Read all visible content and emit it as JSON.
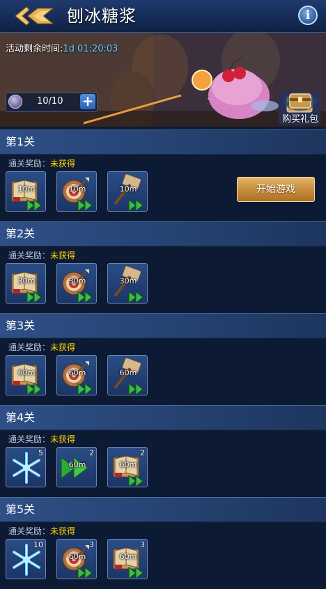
{
  "header": {
    "title": "刨冰糖浆"
  },
  "banner": {
    "timer_label": "活动剩余时间:",
    "timer_value": "1d 01:20:03",
    "stamina": "10/10",
    "plus": "+",
    "gift_label": "购买礼包"
  },
  "reward_prefix": "通关奖励：",
  "start_button": "开始游戏",
  "levels": [
    {
      "title": "第1关",
      "status": "未获得",
      "items": [
        {
          "icon": "book-icon",
          "label": "10m",
          "qty": ""
        },
        {
          "icon": "target-icon",
          "label": "10m",
          "qty": ""
        },
        {
          "icon": "hammer-icon",
          "label": "10m",
          "qty": ""
        }
      ]
    },
    {
      "title": "第2关",
      "status": "未获得",
      "items": [
        {
          "icon": "book-icon",
          "label": "30m",
          "qty": ""
        },
        {
          "icon": "target-icon",
          "label": "30m",
          "qty": ""
        },
        {
          "icon": "hammer-icon",
          "label": "30m",
          "qty": ""
        }
      ]
    },
    {
      "title": "第3关",
      "status": "未获得",
      "items": [
        {
          "icon": "book-icon",
          "label": "60m",
          "qty": ""
        },
        {
          "icon": "target-icon",
          "label": "60m",
          "qty": ""
        },
        {
          "icon": "hammer-icon",
          "label": "60m",
          "qty": ""
        }
      ]
    },
    {
      "title": "第4关",
      "status": "未获得",
      "items": [
        {
          "icon": "snowflake-icon",
          "label": "",
          "qty": "5"
        },
        {
          "icon": "speedup-icon",
          "label": "60m",
          "qty": "2"
        },
        {
          "icon": "book-icon",
          "label": "60m",
          "qty": "2"
        }
      ]
    },
    {
      "title": "第5关",
      "status": "未获得",
      "items": [
        {
          "icon": "snowflake-icon",
          "label": "",
          "qty": "10"
        },
        {
          "icon": "target-icon",
          "label": "60m",
          "qty": "3"
        },
        {
          "icon": "book-icon",
          "label": "60m",
          "qty": "3"
        }
      ]
    }
  ],
  "colors": {
    "accent_gold": "#ffd700",
    "timer_cyan": "#5fd6ff",
    "panel": "#2f4f86"
  }
}
